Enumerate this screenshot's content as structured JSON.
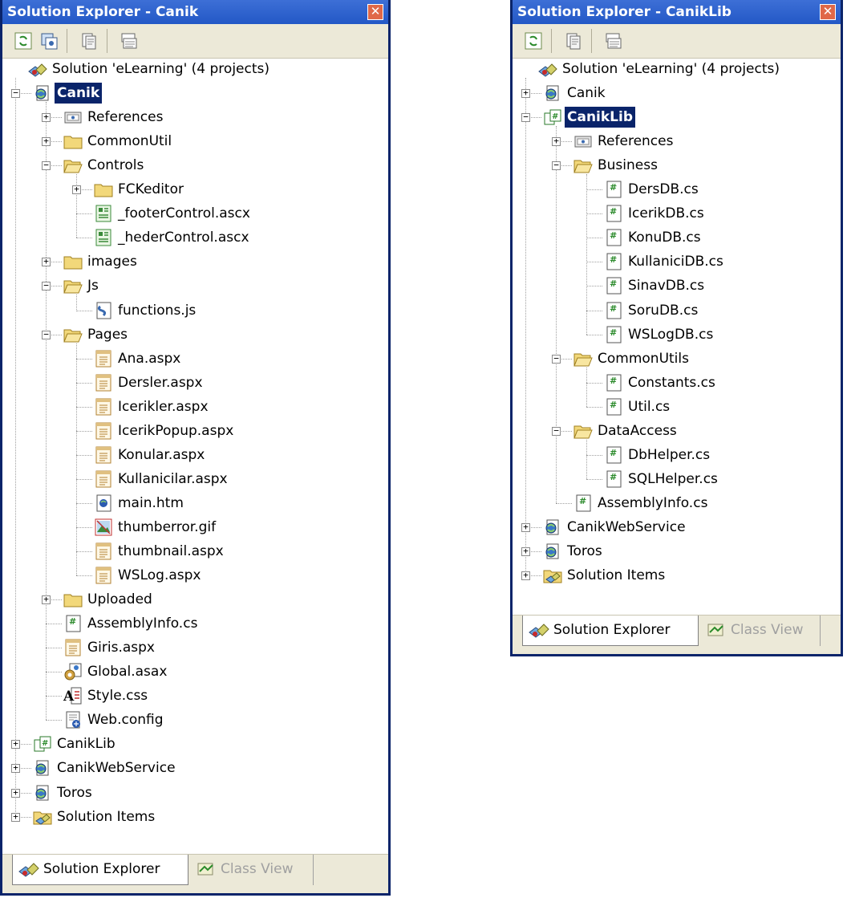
{
  "left": {
    "title": "Solution Explorer - Canik",
    "tabs": [
      "Solution Explorer",
      "Class View"
    ],
    "tree": [
      {
        "label": "Solution 'eLearning' (4 projects)",
        "level": 0,
        "icon": "solution",
        "exp": ""
      },
      {
        "label": "Canik",
        "level": 1,
        "icon": "webproject",
        "exp": "-",
        "sel": true
      },
      {
        "label": "References",
        "level": 2,
        "icon": "references",
        "exp": "+"
      },
      {
        "label": "CommonUtil",
        "level": 2,
        "icon": "folder",
        "exp": "+"
      },
      {
        "label": "Controls",
        "level": 2,
        "icon": "folder-open",
        "exp": "-"
      },
      {
        "label": "FCKeditor",
        "level": 3,
        "icon": "folder",
        "exp": "+"
      },
      {
        "label": "_footerControl.ascx",
        "level": 3,
        "icon": "ascx",
        "exp": ""
      },
      {
        "label": "_hederControl.ascx",
        "level": 3,
        "icon": "ascx",
        "exp": ""
      },
      {
        "label": "images",
        "level": 2,
        "icon": "folder",
        "exp": "+"
      },
      {
        "label": "Js",
        "level": 2,
        "icon": "folder-open",
        "exp": "-"
      },
      {
        "label": "functions.js",
        "level": 3,
        "icon": "js",
        "exp": ""
      },
      {
        "label": "Pages",
        "level": 2,
        "icon": "folder-open",
        "exp": "-"
      },
      {
        "label": "Ana.aspx",
        "level": 3,
        "icon": "aspx",
        "exp": ""
      },
      {
        "label": "Dersler.aspx",
        "level": 3,
        "icon": "aspx",
        "exp": ""
      },
      {
        "label": "Icerikler.aspx",
        "level": 3,
        "icon": "aspx",
        "exp": ""
      },
      {
        "label": "IcerikPopup.aspx",
        "level": 3,
        "icon": "aspx",
        "exp": ""
      },
      {
        "label": "Konular.aspx",
        "level": 3,
        "icon": "aspx",
        "exp": ""
      },
      {
        "label": "Kullanicilar.aspx",
        "level": 3,
        "icon": "aspx",
        "exp": ""
      },
      {
        "label": "main.htm",
        "level": 3,
        "icon": "htm",
        "exp": ""
      },
      {
        "label": "thumberror.gif",
        "level": 3,
        "icon": "gif",
        "exp": ""
      },
      {
        "label": "thumbnail.aspx",
        "level": 3,
        "icon": "aspx",
        "exp": ""
      },
      {
        "label": "WSLog.aspx",
        "level": 3,
        "icon": "aspx",
        "exp": ""
      },
      {
        "label": "Uploaded",
        "level": 2,
        "icon": "folder",
        "exp": "+"
      },
      {
        "label": "AssemblyInfo.cs",
        "level": 2,
        "icon": "cs",
        "exp": ""
      },
      {
        "label": "Giris.aspx",
        "level": 2,
        "icon": "aspx",
        "exp": ""
      },
      {
        "label": "Global.asax",
        "level": 2,
        "icon": "asax",
        "exp": ""
      },
      {
        "label": "Style.css",
        "level": 2,
        "icon": "css",
        "exp": ""
      },
      {
        "label": "Web.config",
        "level": 2,
        "icon": "config",
        "exp": ""
      },
      {
        "label": "CanikLib",
        "level": 1,
        "icon": "csproject",
        "exp": "+"
      },
      {
        "label": "CanikWebService",
        "level": 1,
        "icon": "webproject",
        "exp": "+"
      },
      {
        "label": "Toros",
        "level": 1,
        "icon": "webproject",
        "exp": "+"
      },
      {
        "label": "Solution Items",
        "level": 1,
        "icon": "solutionitems",
        "exp": "+"
      }
    ]
  },
  "right": {
    "title": "Solution Explorer - CanikLib",
    "tabs": [
      "Solution Explorer",
      "Class View"
    ],
    "tree": [
      {
        "label": "Solution 'eLearning' (4 projects)",
        "level": 0,
        "icon": "solution",
        "exp": ""
      },
      {
        "label": "Canik",
        "level": 1,
        "icon": "webproject",
        "exp": "+"
      },
      {
        "label": "CanikLib",
        "level": 1,
        "icon": "csproject",
        "exp": "-",
        "sel": true
      },
      {
        "label": "References",
        "level": 2,
        "icon": "references",
        "exp": "+"
      },
      {
        "label": "Business",
        "level": 2,
        "icon": "folder-open",
        "exp": "-"
      },
      {
        "label": "DersDB.cs",
        "level": 3,
        "icon": "cs",
        "exp": ""
      },
      {
        "label": "IcerikDB.cs",
        "level": 3,
        "icon": "cs",
        "exp": ""
      },
      {
        "label": "KonuDB.cs",
        "level": 3,
        "icon": "cs",
        "exp": ""
      },
      {
        "label": "KullaniciDB.cs",
        "level": 3,
        "icon": "cs",
        "exp": ""
      },
      {
        "label": "SinavDB.cs",
        "level": 3,
        "icon": "cs",
        "exp": ""
      },
      {
        "label": "SoruDB.cs",
        "level": 3,
        "icon": "cs",
        "exp": ""
      },
      {
        "label": "WSLogDB.cs",
        "level": 3,
        "icon": "cs",
        "exp": ""
      },
      {
        "label": "CommonUtils",
        "level": 2,
        "icon": "folder-open",
        "exp": "-"
      },
      {
        "label": "Constants.cs",
        "level": 3,
        "icon": "cs",
        "exp": ""
      },
      {
        "label": "Util.cs",
        "level": 3,
        "icon": "cs",
        "exp": ""
      },
      {
        "label": "DataAccess",
        "level": 2,
        "icon": "folder-open",
        "exp": "-"
      },
      {
        "label": "DbHelper.cs",
        "level": 3,
        "icon": "cs",
        "exp": ""
      },
      {
        "label": "SQLHelper.cs",
        "level": 3,
        "icon": "cs",
        "exp": ""
      },
      {
        "label": "AssemblyInfo.cs",
        "level": 2,
        "icon": "cs",
        "exp": ""
      },
      {
        "label": "CanikWebService",
        "level": 1,
        "icon": "webproject",
        "exp": "+"
      },
      {
        "label": "Toros",
        "level": 1,
        "icon": "webproject",
        "exp": "+"
      },
      {
        "label": "Solution Items",
        "level": 1,
        "icon": "solutionitems",
        "exp": "+"
      }
    ]
  }
}
